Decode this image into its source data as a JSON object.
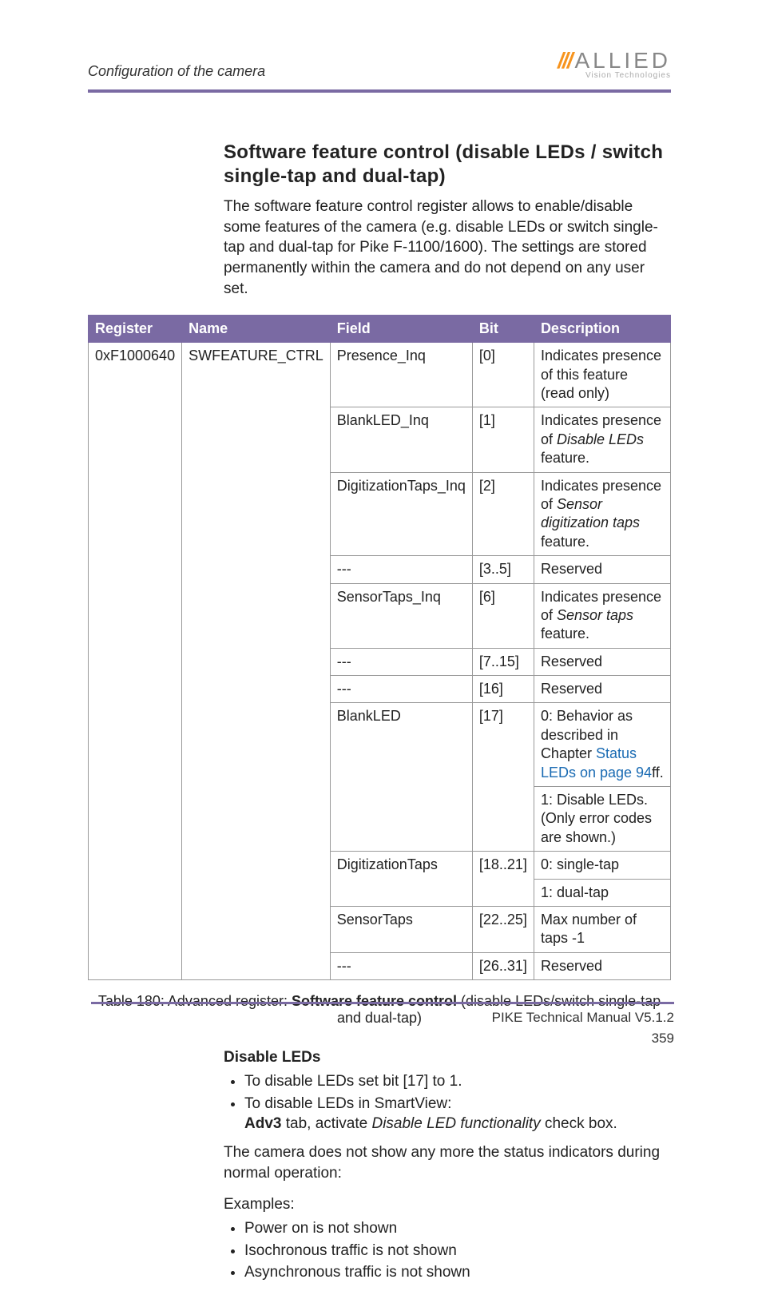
{
  "header": {
    "section": "Configuration of the camera",
    "logo_main": "ALLIED",
    "logo_sub": "Vision Technologies"
  },
  "h1": "Software feature control (disable LEDs / switch single-tap and dual-tap)",
  "intro": "The software feature control register allows to enable/disable some features of the camera (e.g. disable LEDs or switch single-tap and dual-tap for Pike F-1100/1600). The settings are stored permanently within the camera and do not depend on any user set.",
  "table": {
    "headers": {
      "c1": "Register",
      "c2": "Name",
      "c3": "Field",
      "c4": "Bit",
      "c5": "Description"
    },
    "reg": "0xF1000640",
    "name": "SWFEATURE_CTRL",
    "rows": [
      {
        "field": "Presence_Inq",
        "bit": "[0]",
        "desc": "Indicates presence of this feature (read only)"
      },
      {
        "field": "BlankLED_Inq",
        "bit": "[1]",
        "desc_pre": "Indicates presence of ",
        "desc_it": "Disable LEDs",
        "desc_post": " feature."
      },
      {
        "field": "DigitizationTaps_Inq",
        "bit": "[2]",
        "desc_pre": "Indicates presence of ",
        "desc_it": "Sensor digitization taps",
        "desc_post": " feature."
      },
      {
        "field": "---",
        "bit": "[3..5]",
        "desc": "Reserved"
      },
      {
        "field": "SensorTaps_Inq",
        "bit": "[6]",
        "desc_pre": "Indicates presence of ",
        "desc_it": "Sensor taps",
        "desc_post": " feature."
      },
      {
        "field": "---",
        "bit": "[7..15]",
        "desc": "Reserved"
      },
      {
        "field": "---",
        "bit": "[16]",
        "desc": "Reserved"
      },
      {
        "field": "BlankLED",
        "bit": "[17]",
        "desc_a_pre": "0: Behavior as described in Chapter ",
        "desc_a_link": "Status LEDs on page 94",
        "desc_a_post": "ff.",
        "desc_b": "1: Disable LEDs. (Only error codes are shown.)"
      },
      {
        "field": "DigitizationTaps",
        "bit": "[18..21]",
        "desc_a": "0: single-tap",
        "desc_b": "1: dual-tap"
      },
      {
        "field": "SensorTaps",
        "bit": "[22..25]",
        "desc": "Max number of taps -1"
      },
      {
        "field": "---",
        "bit": "[26..31]",
        "desc": "Reserved"
      }
    ]
  },
  "caption_pre": "Table 180: Advanced register: ",
  "caption_bold": "Software feature control",
  "caption_post": " (disable LEDs/switch single-tap and dual-tap)",
  "sub_h": "Disable LEDs",
  "bul1": [
    "To disable LEDs set bit [17] to 1.",
    "To disable LEDs in SmartView:"
  ],
  "bul1_line_bold": "Adv3",
  "bul1_line_mid": " tab, activate ",
  "bul1_line_it": "Disable LED functionality",
  "bul1_line_post": " check box.",
  "para2": "The camera does not show any more the status indicators during normal operation:",
  "para3": "Examples:",
  "bul2": [
    "Power on is not shown",
    "Isochronous traffic is not shown",
    "Asynchronous traffic is not shown"
  ],
  "footer": {
    "manual": "PIKE Technical Manual V5.1.2",
    "page": "359"
  }
}
